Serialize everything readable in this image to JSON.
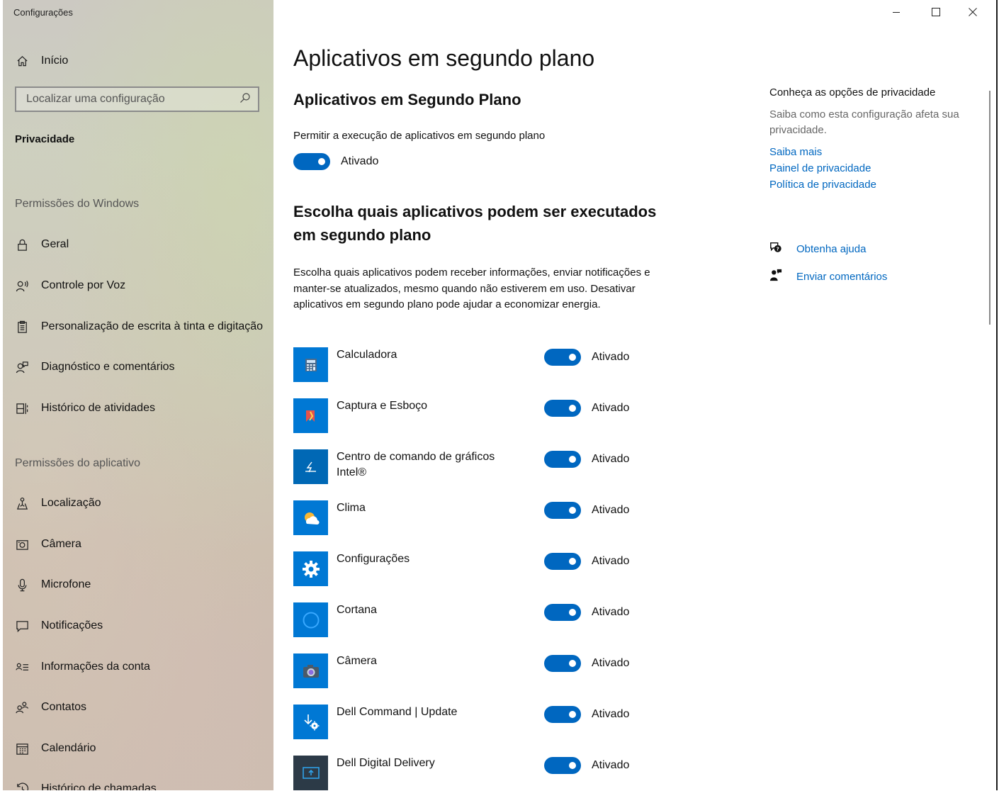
{
  "window": {
    "title": "Configurações"
  },
  "sidebar": {
    "home_label": "Início",
    "search_placeholder": "Localizar uma configuração",
    "current_section": "Privacidade",
    "group_windows": "Permissões do Windows",
    "windows_items": [
      {
        "label": "Geral",
        "icon": "lock-icon"
      },
      {
        "label": "Controle por Voz",
        "icon": "speech-icon"
      },
      {
        "label": "Personalização de escrita à tinta e digitação",
        "icon": "clipboard-icon"
      },
      {
        "label": "Diagnóstico e comentários",
        "icon": "person-feedback-icon"
      },
      {
        "label": "Histórico de atividades",
        "icon": "timeline-icon"
      }
    ],
    "group_apps": "Permissões do aplicativo",
    "app_items": [
      {
        "label": "Localização",
        "icon": "location-icon"
      },
      {
        "label": "Câmera",
        "icon": "camera-icon"
      },
      {
        "label": "Microfone",
        "icon": "microphone-icon"
      },
      {
        "label": "Notificações",
        "icon": "notification-icon"
      },
      {
        "label": "Informações da conta",
        "icon": "account-info-icon"
      },
      {
        "label": "Contatos",
        "icon": "contacts-icon"
      },
      {
        "label": "Calendário",
        "icon": "calendar-icon"
      },
      {
        "label": "Histórico de chamadas",
        "icon": "call-history-icon"
      }
    ]
  },
  "main": {
    "title": "Aplicativos em segundo plano",
    "subtitle": "Aplicativos em Segundo Plano",
    "allow_label": "Permitir a execução de aplicativos em segundo plano",
    "allow_state": "Ativado",
    "choose_heading": "Escolha quais aplicativos podem ser executados em segundo plano",
    "choose_desc": "Escolha quais aplicativos podem receber informações, enviar notificações e manter-se atualizados, mesmo quando não estiverem em uso. Desativar aplicativos em segundo plano pode ajudar a economizar energia.",
    "apps": [
      {
        "name": "Calculadora",
        "state": "Ativado",
        "icon": "calculator-icon"
      },
      {
        "name": "Captura e Esboço",
        "state": "Ativado",
        "icon": "snip-sketch-icon"
      },
      {
        "name": "Centro de comando de gráficos Intel®",
        "state": "Ativado",
        "icon": "intel-graphics-icon"
      },
      {
        "name": "Clima",
        "state": "Ativado",
        "icon": "weather-icon"
      },
      {
        "name": "Configurações",
        "state": "Ativado",
        "icon": "settings-gear-icon"
      },
      {
        "name": "Cortana",
        "state": "Ativado",
        "icon": "cortana-icon"
      },
      {
        "name": "Câmera",
        "state": "Ativado",
        "icon": "camera-app-icon"
      },
      {
        "name": "Dell Command | Update",
        "state": "Ativado",
        "icon": "dell-command-icon"
      },
      {
        "name": "Dell Digital Delivery",
        "state": "Ativado",
        "icon": "dell-delivery-icon"
      }
    ]
  },
  "right": {
    "title": "Conheça as opções de privacidade",
    "desc": "Saiba como esta configuração afeta sua privacidade.",
    "links": [
      "Saiba mais",
      "Painel de privacidade",
      "Política de privacidade"
    ],
    "help_label": "Obtenha ajuda",
    "feedback_label": "Enviar comentários"
  },
  "colors": {
    "accent": "#0067c0",
    "tile": "#0078d4"
  }
}
